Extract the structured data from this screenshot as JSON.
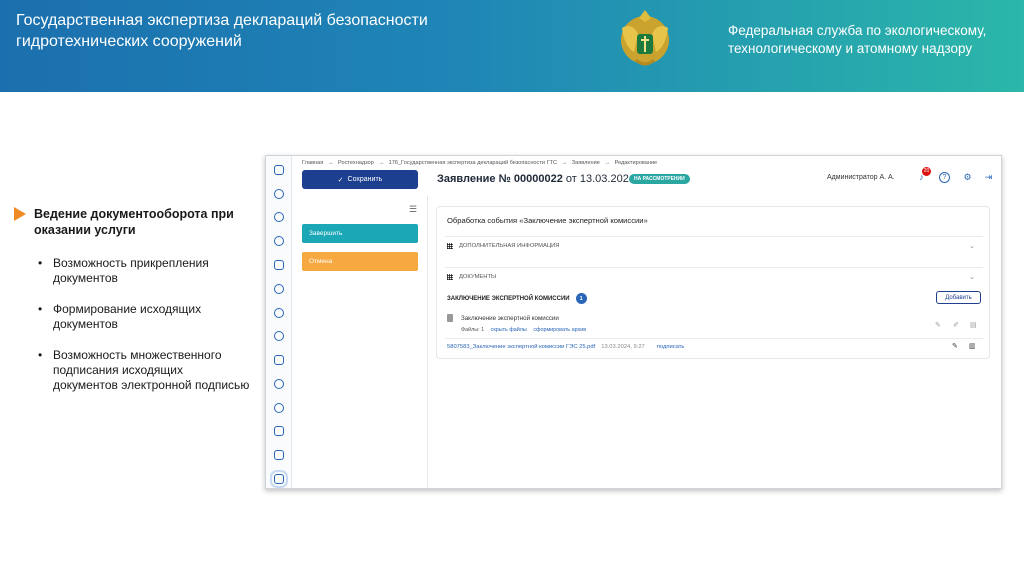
{
  "banner": {
    "title": "Государственная экспертиза деклараций безопасности гидротехнических сооружений",
    "agency": "Федеральная служба по экологическому, технологическому и атомному надзору",
    "emblem_icon": "double-headed-eagle-emblem"
  },
  "bullets": {
    "heading": "Ведение документооборота при оказании услуги",
    "items": [
      "Возможность прикрепления документов",
      "Формирование исходящих документов",
      "Возможность множественного подписания  исходящих документов электронной подписью"
    ]
  },
  "app": {
    "breadcrumbs": [
      "Главная",
      "→",
      "Ростехнадзор",
      "→",
      "176_Государственная экспертиза деклараций безопасности ГТС",
      "→",
      "Заявление",
      "→",
      "Редактирование"
    ],
    "save_label": "Сохранить",
    "title": "Заявление № 00000022",
    "title_date": "от 13.03.2024",
    "status": "НА РАССМОТРЕНИИ",
    "user": "Администратор А. А.",
    "notification_count": "20",
    "finish_label": "Завершить",
    "cancel_label": "Отмена",
    "card": {
      "title": "Обработка события «Заключение экспертной комиссии»",
      "section_additional": "ДОПОЛНИТЕЛЬНАЯ ИНФОРМАЦИЯ",
      "section_documents": "ДОКУМЕНТЫ",
      "docs_heading": "ЗАКЛЮЧЕНИЕ ЭКСПЕРТНОЙ КОМИССИИ",
      "docs_count": "1",
      "add_label": "Добавить",
      "doc_name": "Заключение экспертной комиссии",
      "files_label": "Файлы:",
      "files_count": "1",
      "hide_files": "скрыть файлы",
      "make_archive": "сформировать архив",
      "file_name": "5807583_Заключение экспертной комиссии ГЭС 25.pdf",
      "file_date": "13.03.2024, 9:27",
      "sign_label": "подписать"
    }
  },
  "colors": {
    "primary": "#1d3f8f",
    "teal": "#1ba7b5",
    "orange": "#f5a940",
    "accent_arrow": "#f08a24"
  }
}
